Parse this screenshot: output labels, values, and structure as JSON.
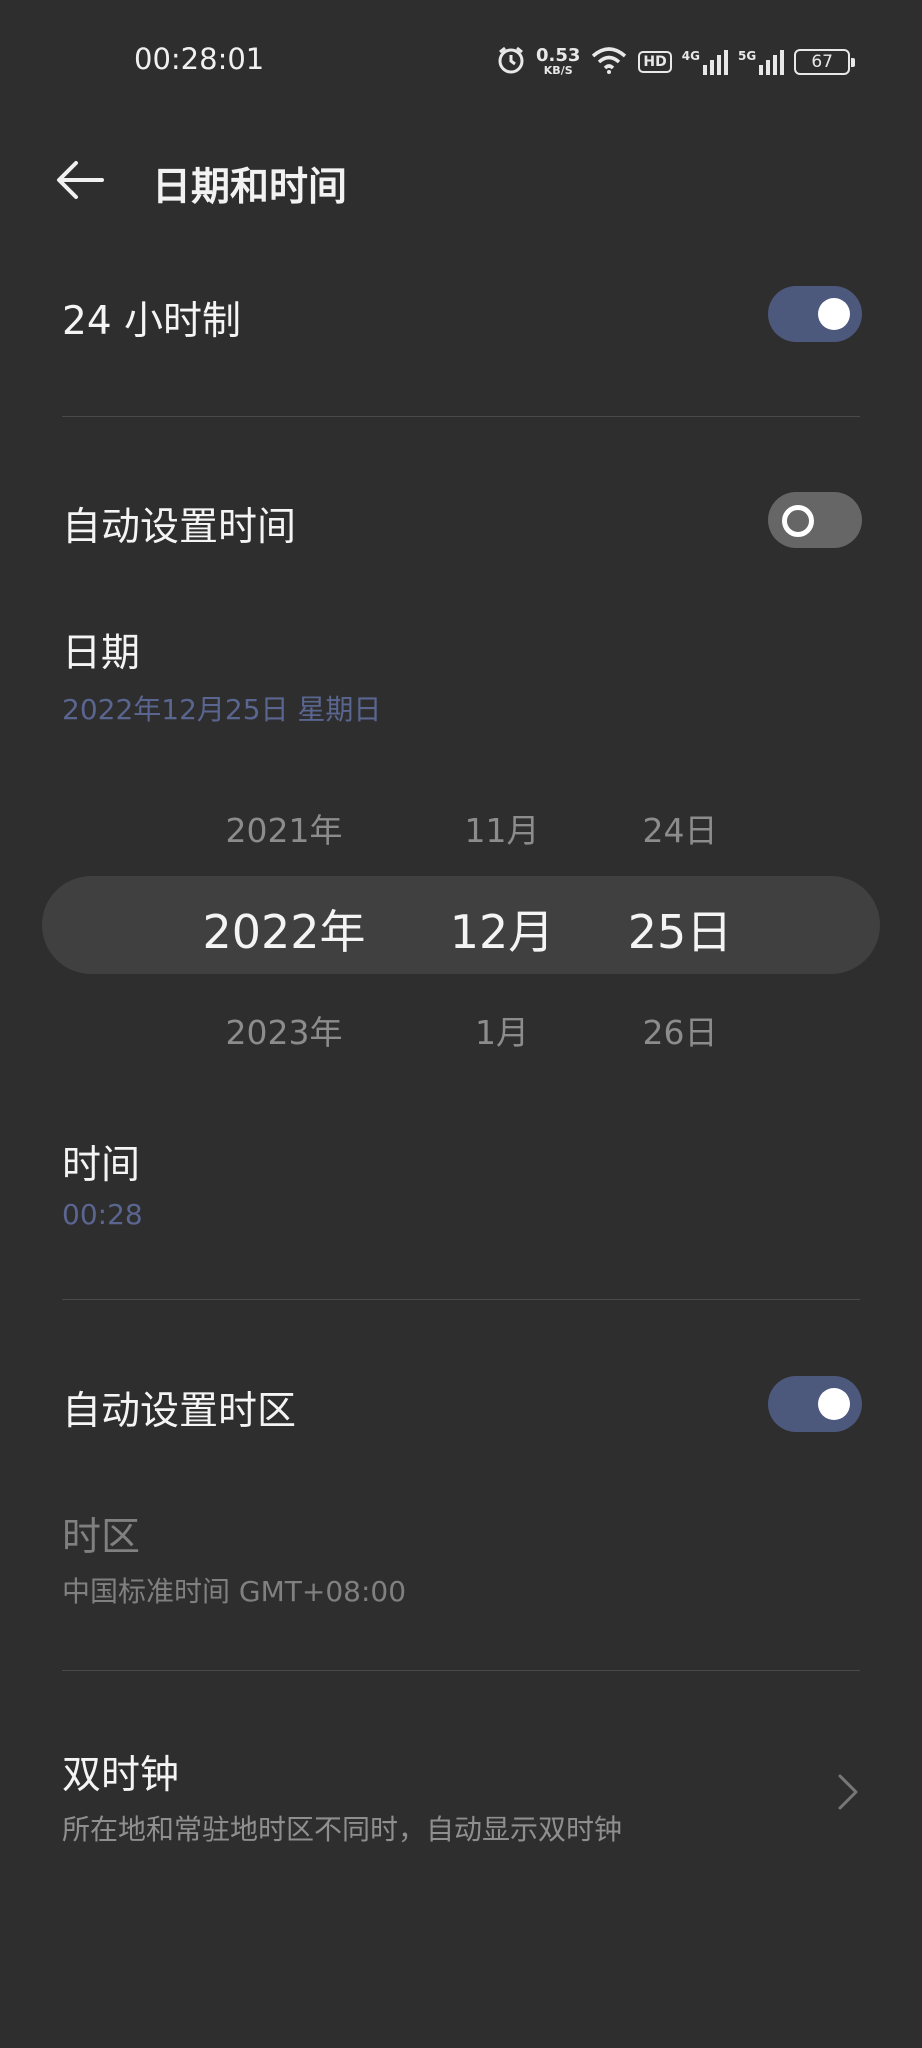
{
  "status_bar": {
    "time": "00:28:01",
    "net_speed_value": "0.53",
    "net_speed_unit": "KB/S",
    "hd_label": "HD",
    "signal1_label": "4G",
    "signal2_label": "5G",
    "battery": "67"
  },
  "header": {
    "title": "日期和时间"
  },
  "hour24": {
    "label": "24 小时制",
    "enabled": true
  },
  "auto_time": {
    "label": "自动设置时间",
    "enabled": false
  },
  "date": {
    "label": "日期",
    "value": "2022年12月25日 星期日"
  },
  "picker": {
    "years": [
      "2021年",
      "2022年",
      "2023年"
    ],
    "months": [
      "11月",
      "12月",
      "1月"
    ],
    "days": [
      "24日",
      "25日",
      "26日"
    ]
  },
  "time": {
    "label": "时间",
    "value": "00:28"
  },
  "auto_timezone": {
    "label": "自动设置时区",
    "enabled": true
  },
  "timezone": {
    "label": "时区",
    "value": "中国标准时间 GMT+08:00"
  },
  "dual_clock": {
    "label": "双时钟",
    "description": "所在地和常驻地时区不同时，自动显示双时钟"
  },
  "colors": {
    "accent": "#4d587d",
    "background": "#2e2e2e",
    "subtext_blue": "#5a6590"
  }
}
